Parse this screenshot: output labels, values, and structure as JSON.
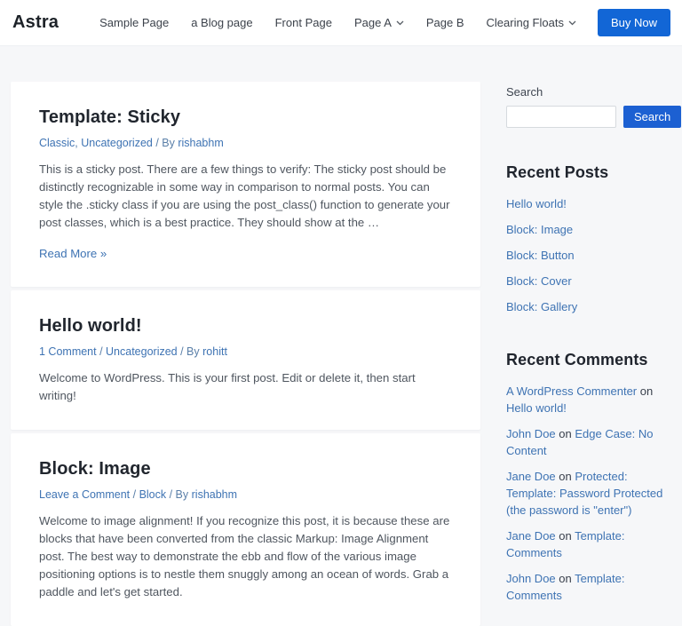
{
  "colors": {
    "page_bg": "#f6f7f9",
    "accent_buy_now": "#1266d6",
    "accent_search_button": "#1c60d2",
    "link_blue": "#3e73b3",
    "heading_dark": "#21262e"
  },
  "header": {
    "logo": "Astra",
    "nav_items": [
      {
        "label": "Sample Page",
        "dropdown": false
      },
      {
        "label": "a Blog page",
        "dropdown": false
      },
      {
        "label": "Front Page",
        "dropdown": false
      },
      {
        "label": "Page A",
        "dropdown": true
      },
      {
        "label": "Page B",
        "dropdown": false
      },
      {
        "label": "Clearing Floats",
        "dropdown": true
      }
    ],
    "buy_now_label": "Buy Now"
  },
  "posts": [
    {
      "title": "Template: Sticky",
      "meta": [
        {
          "text": "Classic",
          "link": true
        },
        {
          "text": ", ",
          "link": false
        },
        {
          "text": "Uncategorized",
          "link": true
        },
        {
          "text": " / By ",
          "link": false
        },
        {
          "text": "rishabhm",
          "link": true
        }
      ],
      "excerpt": "This is a sticky post. There are a few things to verify: The sticky post should be distinctly recognizable in some way in comparison to normal posts. You can style the .sticky class if you are using the post_class() function to generate your post classes, which is a best practice. They should show at the …",
      "read_more": "Read More »"
    },
    {
      "title": "Hello world!",
      "meta": [
        {
          "text": "1 Comment",
          "link": true
        },
        {
          "text": " / ",
          "link": false
        },
        {
          "text": "Uncategorized",
          "link": true
        },
        {
          "text": " / By ",
          "link": false
        },
        {
          "text": "rohitt",
          "link": true
        }
      ],
      "excerpt": "Welcome to WordPress. This is your first post. Edit or delete it, then start writing!",
      "read_more": null
    },
    {
      "title": "Block: Image",
      "meta": [
        {
          "text": "Leave a Comment",
          "link": true
        },
        {
          "text": " / ",
          "link": false
        },
        {
          "text": "Block",
          "link": true
        },
        {
          "text": " / By ",
          "link": false
        },
        {
          "text": "rishabhm",
          "link": true
        }
      ],
      "excerpt": "Welcome to image alignment! If you recognize this post, it is because these are blocks that have been converted from the classic Markup: Image Alignment post. The best way to demonstrate the ebb and flow of the various image positioning options is to nestle them snuggly among an ocean of words. Grab a paddle and let's get started.",
      "read_more": null
    }
  ],
  "sidebar": {
    "search": {
      "title": "Search",
      "input_value": "",
      "button_label": "Search"
    },
    "recent_posts": {
      "title": "Recent Posts",
      "items": [
        "Hello world!",
        "Block: Image",
        "Block: Button",
        "Block: Cover",
        "Block: Gallery"
      ]
    },
    "recent_comments": {
      "title": "Recent Comments",
      "connector": " on ",
      "items": [
        {
          "author": "A WordPress Commenter",
          "post": "Hello world!"
        },
        {
          "author": "John Doe",
          "post": "Edge Case: No Content"
        },
        {
          "author": "Jane Doe",
          "post": "Protected: Template: Password Protected (the password is \"enter\")"
        },
        {
          "author": "Jane Doe",
          "post": "Template: Comments"
        },
        {
          "author": "John Doe",
          "post": "Template: Comments"
        }
      ]
    }
  }
}
